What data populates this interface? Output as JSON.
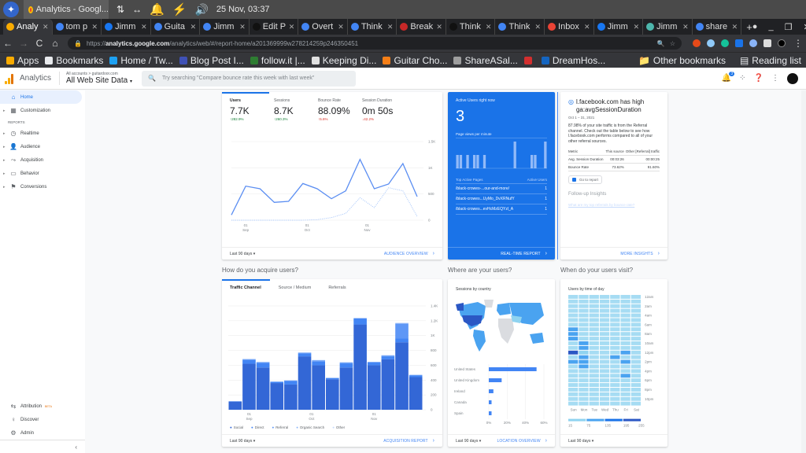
{
  "os_bar": {
    "task_title": "Analytics - Googl...",
    "clock": "25 Nov, 03:37"
  },
  "browser": {
    "tabs": [
      {
        "label": "Analy",
        "favicon": "analytics-icon",
        "color": "#f9ab00",
        "active": true
      },
      {
        "label": "tom p",
        "favicon": "google-icon",
        "color": "#4285f4"
      },
      {
        "label": "Jimm",
        "favicon": "facebook-icon",
        "color": "#1877f2"
      },
      {
        "label": "Guita",
        "favicon": "google-icon",
        "color": "#4285f4"
      },
      {
        "label": "Jimm",
        "favicon": "google-icon",
        "color": "#4285f4"
      },
      {
        "label": "Edit P",
        "favicon": "page-icon",
        "color": "#111111"
      },
      {
        "label": "Overt",
        "favicon": "google-icon",
        "color": "#4285f4"
      },
      {
        "label": "Think",
        "favicon": "google-icon",
        "color": "#4285f4"
      },
      {
        "label": "Break",
        "favicon": "news-icon",
        "color": "#c62828"
      },
      {
        "label": "Think",
        "favicon": "page-icon",
        "color": "#111111"
      },
      {
        "label": "Think",
        "favicon": "google-icon",
        "color": "#4285f4"
      },
      {
        "label": "Inbox",
        "favicon": "gmail-icon",
        "color": "#ea4335"
      },
      {
        "label": "Jimm",
        "favicon": "facebook-icon",
        "color": "#1877f2"
      },
      {
        "label": "Jimm",
        "favicon": "image-icon",
        "color": "#4db6ac"
      },
      {
        "label": "share",
        "favicon": "google-icon",
        "color": "#4285f4"
      }
    ],
    "url_prefix": "https://",
    "url_domain": "analytics.google.com",
    "url_path": "/analytics/web/#/report-home/a201369999w278214259p246350451",
    "bookmarks": [
      {
        "label": "Apps",
        "color": "#f9ab00"
      },
      {
        "label": "Bookmarks",
        "color": "#e8eaed"
      },
      {
        "label": "Home / Tw...",
        "color": "#1da1f2"
      },
      {
        "label": "Blog Post I...",
        "color": "#3f51b5"
      },
      {
        "label": "follow.it |...",
        "color": "#2e7d32"
      },
      {
        "label": "Keeping Di...",
        "color": "#e0e0e0"
      },
      {
        "label": "Guitar Cho...",
        "color": "#f57f17"
      },
      {
        "label": "ShareASal...",
        "color": "#9e9e9e"
      },
      {
        "label": "",
        "color": "#d32f2f"
      },
      {
        "label": "DreamHos...",
        "color": "#1565c0"
      }
    ],
    "other_bookmarks": "Other bookmarks",
    "reading_list": "Reading list"
  },
  "ga_header": {
    "app_name": "Analytics",
    "breadcrumb": "All accounts > guitardoor.com",
    "property": "All Web Site Data",
    "search_placeholder": "Try searching \"Compare bounce rate this week with last week\"",
    "notification_count": "3"
  },
  "sidebar": {
    "items": [
      {
        "label": "Home",
        "icon": "home-icon",
        "glyph": "⌂",
        "active": true
      },
      {
        "label": "Customization",
        "icon": "customization-icon",
        "glyph": "▦"
      }
    ],
    "reports_heading": "REPORTS",
    "reports": [
      {
        "label": "Realtime",
        "icon": "clock-icon",
        "glyph": "◷"
      },
      {
        "label": "Audience",
        "icon": "person-icon",
        "glyph": "👤"
      },
      {
        "label": "Acquisition",
        "icon": "acquisition-icon",
        "glyph": "⤳"
      },
      {
        "label": "Behavior",
        "icon": "behavior-icon",
        "glyph": "▭"
      },
      {
        "label": "Conversions",
        "icon": "flag-icon",
        "glyph": "⚑"
      }
    ],
    "bottom": [
      {
        "label": "Attribution",
        "badge": "BETA",
        "icon": "attribution-icon",
        "glyph": "⇆"
      },
      {
        "label": "Discover",
        "icon": "lightbulb-icon",
        "glyph": "♀"
      },
      {
        "label": "Admin",
        "icon": "gear-icon",
        "glyph": "⚙"
      }
    ]
  },
  "audience_card": {
    "metrics": [
      {
        "label": "Users",
        "value": "7.7K",
        "delta": "↑282.9%",
        "trend": "up-green"
      },
      {
        "label": "Sessions",
        "value": "8.7K",
        "delta": "↑260.3%",
        "trend": "up-green"
      },
      {
        "label": "Bounce Rate",
        "value": "88.09%",
        "delta": "↑5.6%",
        "trend": "up-red"
      },
      {
        "label": "Session Duration",
        "value": "0m 50s",
        "delta": "↓42.2%",
        "trend": "up-red"
      }
    ],
    "range": "Last 90 days",
    "link": "AUDIENCE OVERVIEW"
  },
  "realtime_card": {
    "title": "Active Users right now",
    "count": "3",
    "pageviews_label": "Page views per minute",
    "pageviews": [
      1,
      1,
      0,
      1,
      0,
      1,
      1,
      0,
      1,
      0,
      0,
      0,
      0,
      0,
      0,
      0,
      0,
      2,
      0,
      0,
      0,
      0,
      1,
      1,
      0,
      0,
      2
    ],
    "top_pages_label": "Top Active Pages",
    "active_users_label": "Active Users",
    "pages": [
      {
        "path": "/black-crowes-...our-and-more/",
        "users": "1"
      },
      {
        "path": "/black-crowes...UyMo_DvXRNufY",
        "users": "1"
      },
      {
        "path": "/black-crowes...evHcMzEQYzl_A",
        "users": "1"
      }
    ],
    "link": "REAL-TIME REPORT"
  },
  "insight_card": {
    "title": "l.facebook.com has high ga:avgSessionDuration",
    "date_range": "Oct 1 – 31, 2021",
    "body": "87.98% of your site traffic is from the Referral channel. Check out the table below to see how l.facebook.com performs compared to all of your other referral sources.",
    "table_headers": [
      "Metric",
      "This source",
      "Other [Referral] traffic"
    ],
    "table_rows": [
      [
        "Avg. Session Duration",
        "00:03:26",
        "00:00:25"
      ],
      [
        "Bounce Rate",
        "73.62%",
        "91.60%"
      ]
    ],
    "go_to_report": "Go to report",
    "followup_heading": "Follow-up Insights",
    "followup_link": "What are my top referrals by bounce rate?",
    "link": "MORE INSIGHTS"
  },
  "acquire_section": {
    "title": "How do you acquire users?",
    "tabs": [
      "Traffic Channel",
      "Source / Medium",
      "Referrals"
    ],
    "range": "Last 90 days",
    "link": "ACQUISITION REPORT"
  },
  "where_section": {
    "title": "Where are your users?",
    "card_title": "Sessions by country",
    "range": "Last 90 days",
    "link": "LOCATION OVERVIEW"
  },
  "when_section": {
    "title": "When do your users visit?",
    "card_title": "Users by time of day",
    "range": "Last 90 days"
  },
  "chart_data": [
    {
      "id": "users-line",
      "type": "line",
      "title": "Users",
      "x_ticks": [
        {
          "label": "01",
          "sub": "Sep",
          "index": 1
        },
        {
          "label": "01",
          "sub": "Oct",
          "index": 5.3
        },
        {
          "label": "01",
          "sub": "Nov",
          "index": 9.5
        }
      ],
      "ylim": [
        0,
        1500
      ],
      "y_ticks": [
        "0",
        "500",
        "1K",
        "1.5K"
      ],
      "y_tick_values": [
        0,
        500,
        1000,
        1500
      ],
      "series": [
        {
          "name": "Users (current)",
          "style": "solid",
          "values": [
            100,
            650,
            600,
            340,
            360,
            700,
            600,
            410,
            560,
            1160,
            600,
            690,
            1080,
            450
          ]
        },
        {
          "name": "Users (previous)",
          "style": "dotted",
          "values": [
            0,
            0,
            0,
            0,
            0,
            0,
            10,
            50,
            130,
            430,
            240,
            620,
            560,
            70
          ]
        }
      ]
    },
    {
      "id": "traffic-bars",
      "type": "bar",
      "stacked": true,
      "x_ticks": [
        {
          "label": "01",
          "sub": "Sep",
          "index": 1
        },
        {
          "label": "01",
          "sub": "Oct",
          "index": 5.5
        },
        {
          "label": "01",
          "sub": "Nov",
          "index": 10
        }
      ],
      "ylim": [
        0,
        1400
      ],
      "y_ticks": [
        "0",
        "200",
        "400",
        "600",
        "800",
        "1K",
        "1.2K",
        "1.4K"
      ],
      "y_tick_values": [
        0,
        200,
        400,
        600,
        800,
        1000,
        1200,
        1400
      ],
      "legend": [
        "Social",
        "Direct",
        "Referral",
        "Organic Search",
        "Other"
      ],
      "legend_colors": [
        "#3367d6",
        "#4285f4",
        "#5e97f6",
        "#8ab4f8",
        "#c6dafc"
      ],
      "series": [
        {
          "name": "Social",
          "values": [
            110,
            620,
            570,
            360,
            340,
            720,
            600,
            410,
            570,
            1150,
            600,
            680,
            910,
            440
          ]
        },
        {
          "name": "Direct",
          "values": [
            0,
            50,
            60,
            15,
            50,
            40,
            50,
            15,
            55,
            80,
            40,
            40,
            50,
            25
          ]
        },
        {
          "name": "Referral",
          "values": [
            5,
            10,
            10,
            5,
            5,
            10,
            15,
            5,
            10,
            5,
            5,
            10,
            200,
            5
          ]
        },
        {
          "name": "Organic Search",
          "values": [
            0,
            5,
            5,
            0,
            0,
            0,
            5,
            0,
            5,
            0,
            0,
            5,
            10,
            0
          ]
        },
        {
          "name": "Other",
          "values": [
            0,
            0,
            0,
            0,
            0,
            0,
            0,
            0,
            0,
            0,
            0,
            0,
            0,
            0
          ]
        }
      ]
    },
    {
      "id": "country-bars",
      "type": "bar",
      "orientation": "horizontal",
      "categories": [
        "United States",
        "United Kingdom",
        "Ireland",
        "Canada",
        "Spain"
      ],
      "values": [
        52,
        14,
        5,
        3,
        3
      ],
      "xlim": [
        0,
        60
      ],
      "x_ticks": [
        "0%",
        "20%",
        "40%",
        "60%"
      ],
      "x_tick_values": [
        0,
        20,
        40,
        60
      ]
    },
    {
      "id": "time-heatmap",
      "type": "heatmap",
      "columns": [
        "Sun",
        "Mon",
        "Tue",
        "Wed",
        "Thu",
        "Fri",
        "Sat"
      ],
      "row_labels": [
        "12am",
        "2am",
        "4am",
        "6am",
        "8am",
        "10am",
        "12pm",
        "2pm",
        "4pm",
        "6pm",
        "8pm",
        "10pm"
      ],
      "scale": [
        "15",
        "75",
        "135",
        "195",
        "255"
      ],
      "scale_colors": [
        "#8fd3f0",
        "#4aa3f0",
        "#1a73e8",
        "#2b57c4"
      ],
      "base_color": "#a6dcf3",
      "hot_cells": [
        {
          "day": 0,
          "hour": 7,
          "level": 1
        },
        {
          "day": 0,
          "hour": 8,
          "level": 1
        },
        {
          "day": 0,
          "hour": 9,
          "level": 1
        },
        {
          "day": 0,
          "hour": 12,
          "level": 3
        },
        {
          "day": 0,
          "hour": 14,
          "level": 1
        },
        {
          "day": 1,
          "hour": 10,
          "level": 1
        },
        {
          "day": 1,
          "hour": 11,
          "level": 1
        },
        {
          "day": 1,
          "hour": 12,
          "level": 0
        },
        {
          "day": 1,
          "hour": 13,
          "level": 1
        },
        {
          "day": 1,
          "hour": 14,
          "level": 1
        },
        {
          "day": 1,
          "hour": 15,
          "level": 1
        },
        {
          "day": 4,
          "hour": 13,
          "level": 1
        },
        {
          "day": 5,
          "hour": 12,
          "level": 1
        },
        {
          "day": 5,
          "hour": 14,
          "level": 1
        },
        {
          "day": 5,
          "hour": 17,
          "level": 1
        }
      ]
    }
  ]
}
